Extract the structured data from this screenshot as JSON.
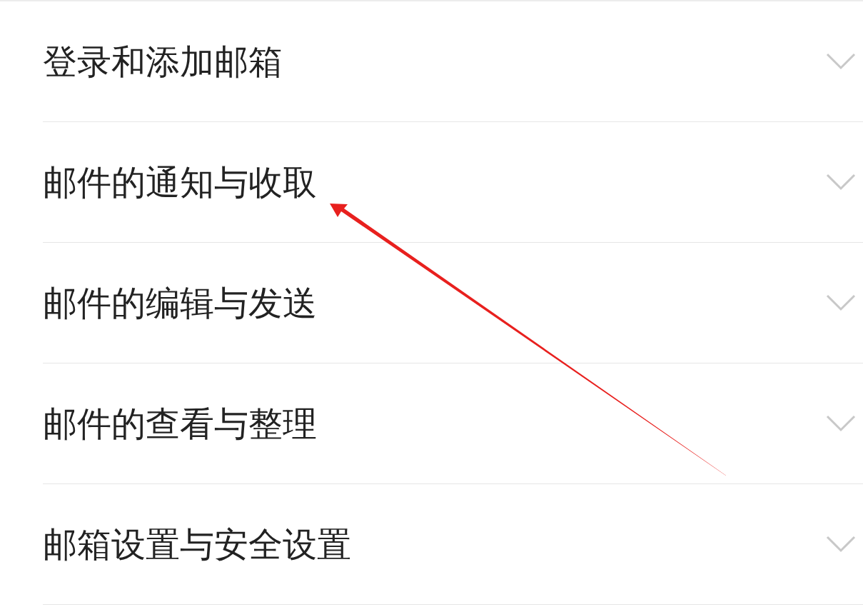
{
  "menu": {
    "items": [
      {
        "label": "登录和添加邮箱",
        "expanded": false
      },
      {
        "label": "邮件的通知与收取",
        "expanded": false
      },
      {
        "label": "邮件的编辑与发送",
        "expanded": false
      },
      {
        "label": "邮件的查看与整理",
        "expanded": false
      },
      {
        "label": "邮箱设置与安全设置",
        "expanded": false
      }
    ]
  }
}
